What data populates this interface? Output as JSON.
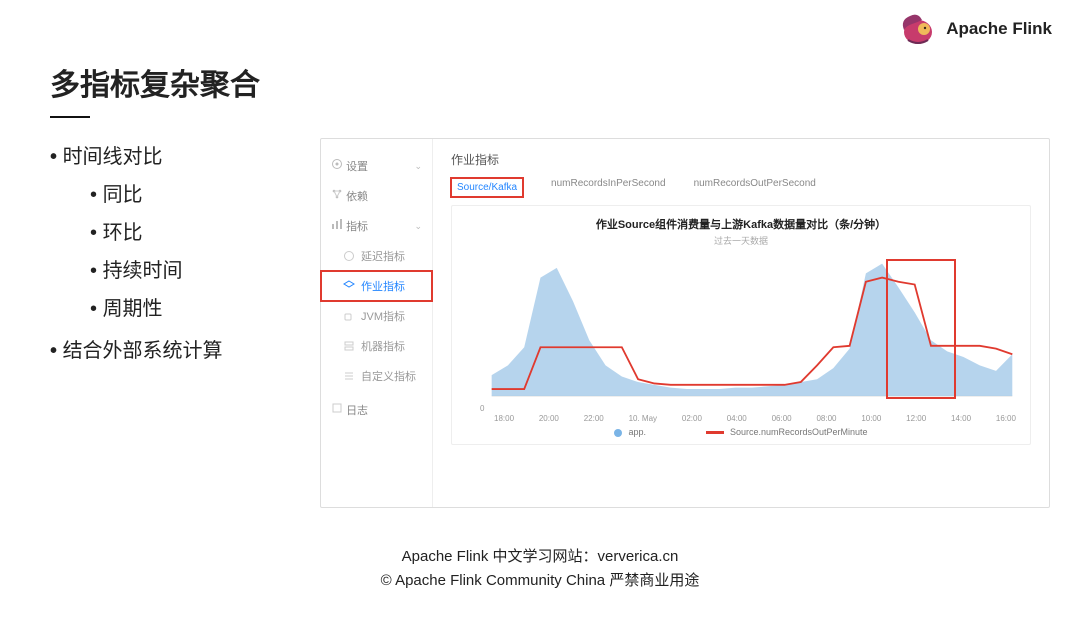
{
  "brand": "Apache Flink",
  "title": "多指标复杂聚合",
  "bullets": {
    "a": "时间线对比",
    "a1": "同比",
    "a2": "环比",
    "a3": "持续时间",
    "a4": "周期性",
    "b": "结合外部系统计算"
  },
  "sidebar": {
    "settings": "设置",
    "deps": "依赖",
    "metrics": "指标",
    "sub_delay": "延迟指标",
    "sub_job": "作业指标",
    "sub_jvm": "JVM指标",
    "sub_machine": "机器指标",
    "sub_custom": "自定义指标",
    "logs": "日志"
  },
  "panel": {
    "title": "作业指标",
    "tab_active": "Source/Kafka",
    "tab2": "numRecordsInPerSecond",
    "tab3": "numRecordsOutPerSecond",
    "chart_title": "作业Source组件消费量与上游Kafka数据量对比（条/分钟）",
    "chart_sub": "过去一天数据",
    "legend_a": "app.",
    "legend_b": "Source.numRecordsOutPerMinute",
    "ylabel0": "0"
  },
  "footer": {
    "l1": "Apache Flink 中文学习网站：ververica.cn",
    "l2": "© Apache Flink Community China  严禁商业用途"
  },
  "chart_data": {
    "type": "area+line",
    "x_ticks": [
      "18:00",
      "20:00",
      "22:00",
      "10. May",
      "02:00",
      "04:00",
      "06:00",
      "08:00",
      "10:00",
      "12:00",
      "14:00",
      "16:00"
    ],
    "ylim": [
      0,
      100
    ],
    "series": [
      {
        "name": "app.",
        "style": "area-blue",
        "values": [
          15,
          22,
          35,
          85,
          92,
          68,
          40,
          22,
          14,
          10,
          8,
          6,
          5,
          5,
          5,
          6,
          6,
          7,
          8,
          10,
          12,
          20,
          34,
          88,
          95,
          78,
          60,
          40,
          32,
          28,
          22,
          18,
          30
        ]
      },
      {
        "name": "Source.numRecordsOutPerMinute",
        "style": "line-red",
        "values": [
          5,
          5,
          5,
          35,
          35,
          35,
          35,
          35,
          35,
          12,
          9,
          8,
          8,
          8,
          8,
          8,
          8,
          8,
          8,
          10,
          22,
          35,
          36,
          82,
          85,
          82,
          80,
          36,
          36,
          36,
          36,
          34,
          30
        ]
      }
    ]
  }
}
